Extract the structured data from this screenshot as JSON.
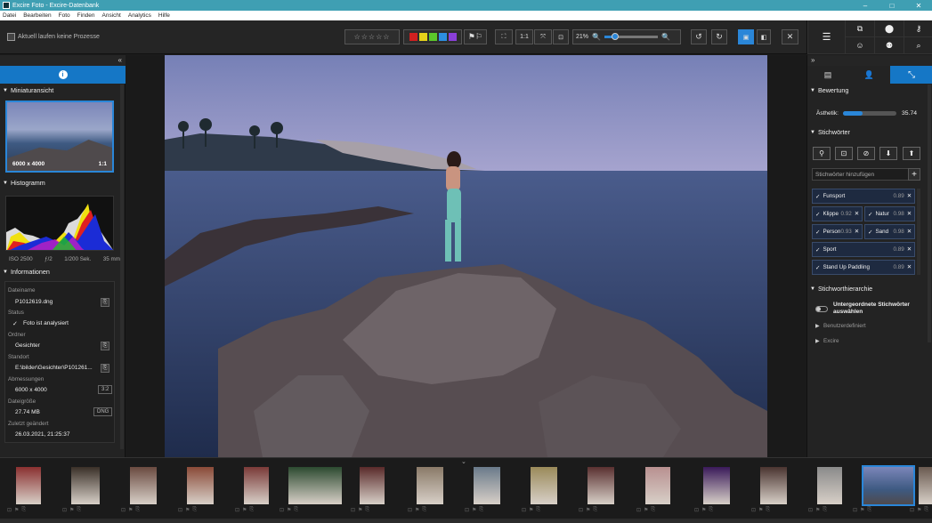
{
  "window": {
    "title": "Excire Foto - Excire-Datenbank",
    "buttons": [
      "–",
      "□",
      "✕"
    ]
  },
  "menu": [
    "Datei",
    "Bearbeiten",
    "Foto",
    "Finden",
    "Ansicht",
    "Analytics",
    "Hilfe"
  ],
  "toolbar": {
    "status": "Aktuell laufen keine Prozesse",
    "ratio_1to1": "1:1",
    "zoom": "21%",
    "zoom_fraction": 0.2,
    "colors": [
      "#d02020",
      "#e5d21a",
      "#5bc62a",
      "#2c8ee0",
      "#8a3fd9"
    ]
  },
  "left": {
    "collapse": "«",
    "thumbnail": {
      "title": "Miniaturansicht",
      "dims": "6000 x 4000",
      "ratio": "1:1"
    },
    "histogram": {
      "title": "Histogramm",
      "iso": "ISO 2500",
      "aperture": "ƒ/2",
      "shutter": "1/200 Sek.",
      "focal": "35 mm"
    },
    "info": {
      "title": "Informationen",
      "filename_label": "Dateiname",
      "filename": "P1012619.dng",
      "status_label": "Status",
      "status": "Foto ist analysiert",
      "folder_label": "Ordner",
      "folder": "Gesichter",
      "location_label": "Standort",
      "location": "E:\\bilder\\Gesichter\\P101261...",
      "dimensions_label": "Abmessungen",
      "dimensions": "6000 x 4000",
      "aspect": "3:2",
      "filesize_label": "Dateigröße",
      "filesize": "27.74 MB",
      "format": "DNG",
      "modified_label": "Zuletzt geändert",
      "modified": "26.03.2021, 21:25:37"
    }
  },
  "right": {
    "collapse": "»",
    "rating": {
      "title": "Bewertung",
      "aesthetic_label": "Ästhetik:",
      "aesthetic_value": "35.74",
      "aesthetic_fraction": 0.36
    },
    "keywords": {
      "title": "Stichwörter",
      "placeholder": "Stichwörter hinzufügen",
      "add": "+",
      "items": [
        {
          "label": "Funsport",
          "score": "0.89"
        },
        {
          "label": "Klippe",
          "score": "0.92"
        },
        {
          "label": "Natur",
          "score": "0.98"
        },
        {
          "label": "Person",
          "score": "0.93"
        },
        {
          "label": "Sand",
          "score": "0.98"
        },
        {
          "label": "Sport",
          "score": "0.89"
        },
        {
          "label": "Stand Up Paddling",
          "score": "0.89"
        }
      ]
    },
    "hierarchy": {
      "title": "Stichworthierarchie",
      "sub_label": "Untergeordnete Stichwörter auswählen",
      "nodes": [
        "Benutzerdefiniert",
        "Excire"
      ]
    }
  },
  "filmstrip": {
    "count": 17,
    "selected": 15
  }
}
